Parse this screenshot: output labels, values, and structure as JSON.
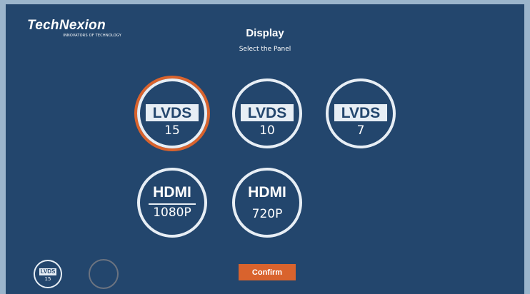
{
  "brand": {
    "name": "TechNexion",
    "tagline": "INNOVATORS OF TECHNOLOGY"
  },
  "header": {
    "title": "Display",
    "subtitle": "Select the Panel"
  },
  "panels": [
    {
      "tag": "LVDS",
      "value": "15",
      "selected": true
    },
    {
      "tag": "LVDS",
      "value": "10",
      "selected": false
    },
    {
      "tag": "LVDS",
      "value": "7",
      "selected": false
    },
    {
      "tag": "HDMI",
      "value": "1080P",
      "selected": false
    },
    {
      "tag": "HDMI",
      "value": "720P",
      "selected": false
    }
  ],
  "selection_preview": {
    "tag": "LVDS",
    "value": "15"
  },
  "confirm_label": "Confirm",
  "colors": {
    "background": "#23466d",
    "outer": "#9bb5cc",
    "accent": "#d9632d",
    "ring": "#e7eef5",
    "empty_slot": "#6b7380"
  }
}
